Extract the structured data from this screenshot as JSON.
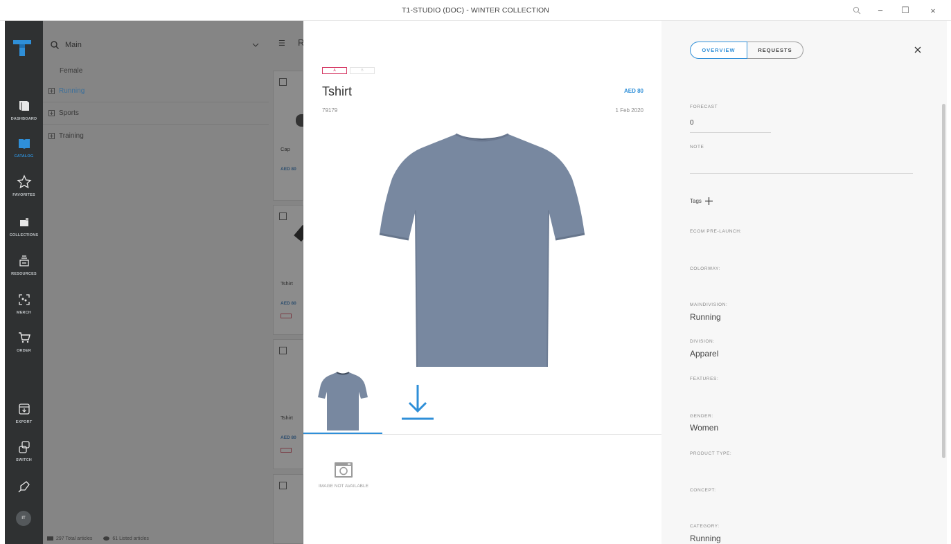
{
  "window": {
    "title": "T1-STUDIO (DOC) - WINTER COLLECTION",
    "minimize": "−",
    "maximize": "☐",
    "close": "×"
  },
  "leftnav": {
    "items": [
      {
        "label": "DASHBOARD",
        "icon": "book-icon"
      },
      {
        "label": "CATALOG",
        "icon": "catalog-icon",
        "active": true
      },
      {
        "label": "FAVORITES",
        "icon": "star-icon"
      },
      {
        "label": "COLLECTIONS",
        "icon": "collections-icon"
      },
      {
        "label": "RESOURCES",
        "icon": "resources-icon"
      },
      {
        "label": "MERCH",
        "icon": "merch-icon"
      },
      {
        "label": "ORDER",
        "icon": "cart-icon"
      },
      {
        "label": "EXPORT",
        "icon": "export-icon"
      },
      {
        "label": "SWITCH",
        "icon": "switch-icon"
      }
    ],
    "avatar": "IT"
  },
  "filters": {
    "search_value": "Main",
    "group": "Female",
    "items": [
      "Running",
      "Sports",
      "Training"
    ]
  },
  "statusbar": {
    "total": "297 Total articles",
    "listed": "61 Listed articles"
  },
  "cards": {
    "header": "R",
    "items": [
      {
        "name": "Cap",
        "price": "AED 80"
      },
      {
        "name": "Tshirt",
        "price": "AED 80"
      },
      {
        "name": "Tshirt",
        "price": "AED 80"
      }
    ]
  },
  "product": {
    "badge_a": "A",
    "badge_b": "B",
    "title": "Tshirt",
    "price": "AED 80",
    "code": "79179",
    "date": "1 Feb 2020",
    "no_image": "IMAGE NOT AVAILABLE",
    "colors": {
      "shirt": "#7888a0",
      "accent": "#2f8fd8"
    }
  },
  "details": {
    "tabs": [
      "OVERVIEW",
      "REQUESTS"
    ],
    "forecast_label": "FORECAST",
    "forecast_value": "0",
    "note_label": "NOTE",
    "tags_label": "Tags",
    "ecom_label": "ECOM PRE-LAUNCH:",
    "colorway_label": "COLORWAY:",
    "maindivision_label": "MAINDIVISION:",
    "maindivision_value": "Running",
    "division_label": "DIVISION:",
    "division_value": "Apparel",
    "features_label": "FEATURES:",
    "gender_label": "GENDER:",
    "gender_value": "Women",
    "producttype_label": "PRODUCT TYPE:",
    "concept_label": "CONCEPT:",
    "category_label": "CATEGORY:",
    "category_value": "Running"
  }
}
